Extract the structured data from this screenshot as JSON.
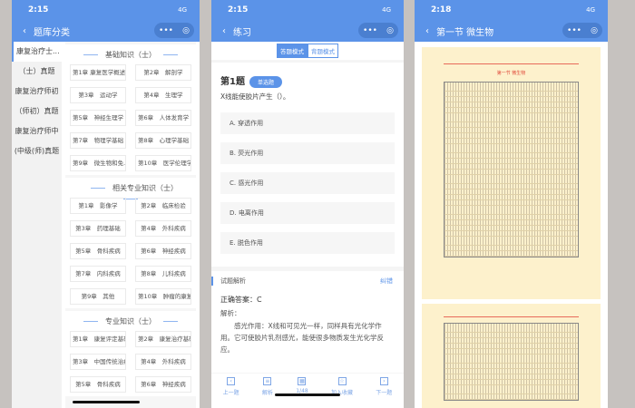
{
  "phone1": {
    "time": "2:15",
    "signal": "4G",
    "title": "题库分类",
    "sidebar": [
      "康复治疗士...",
      "（士）真题",
      "康复治疗师初",
      "（师初）真题",
      "康复治疗师中",
      "(中级(师)真题"
    ],
    "sections": [
      {
        "title": "基础知识（士）",
        "items": [
          "第1章 康复医学概述",
          "第2章　解剖学",
          "第3章　运动学",
          "第4章　生理学",
          "第5章　神经生理学",
          "第6章　人体发育学",
          "第7章　物理学基础",
          "第8章　心理学基础",
          "第9章　微生物和免...",
          "第10章　医学伦理学"
        ]
      },
      {
        "title": "相关专业知识（士）",
        "items": [
          "第1章　影像学",
          "第2章　临床检验",
          "第3章　药理基础",
          "第4章　外科疾病",
          "第5章　骨科疾病",
          "第6章　神经疾病",
          "第7章　内科疾病",
          "第8章　儿科疾病",
          "第9章　其他",
          "第10章　肿瘤的康复"
        ]
      },
      {
        "title": "专业知识（士）",
        "items": [
          "第1章　康复评定基础",
          "第2章　康复治疗基础",
          "第3章　中国传统治疗",
          "第4章　外科疾病",
          "第5章　骨科疾病",
          "第6章　神经疾病"
        ]
      }
    ]
  },
  "phone2": {
    "time": "2:15",
    "signal": "4G",
    "title": "练习",
    "mode_answer": "答题模式",
    "mode_recite": "背题模式",
    "question_no": "第1题",
    "question_type": "单选题",
    "question": "X线能使胶片产生（）。",
    "options": [
      "A. 穿透作用",
      "B. 荧光作用",
      "C. 感光作用",
      "D. 电离作用",
      "E. 脱色作用"
    ],
    "analysis_title": "试题解析",
    "report": "纠错",
    "answer": "正确答案：C",
    "analysis_label": "解析：",
    "analysis_text": "感光作用：X线和可见光一样，同样具有光化学作用。它可使胶片乳剂感光，能使很多物质发生光化学反应。",
    "bottom": [
      "上一题",
      "解析",
      "1/48",
      "加入收藏",
      "下一题"
    ]
  },
  "phone3": {
    "time": "2:18",
    "signal": "4G",
    "title": "第一节 微生物",
    "doc_heading": "第一节 微生物"
  },
  "colors": {
    "primary": "#5b93e8",
    "paper": "#fdf1cc"
  }
}
